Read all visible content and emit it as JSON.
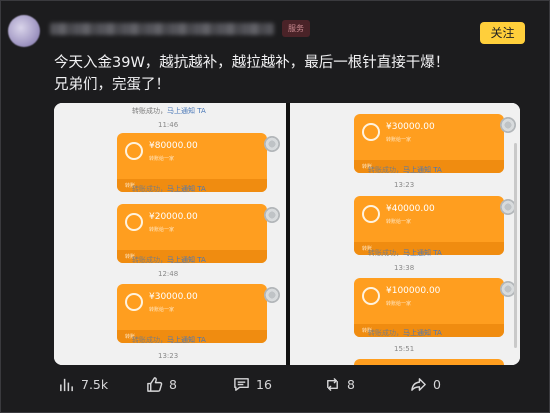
{
  "header": {
    "follow_label": "关注",
    "tag_label": "服务"
  },
  "post": {
    "line1": "今天入金39W，越抗越补，越拉越补，最后一根针直接干爆！",
    "line2": "兄弟们，完蛋了！"
  },
  "screenshot": {
    "left": {
      "top_status": "转账成功，",
      "top_link": "马上通知 TA",
      "bubbles": [
        {
          "amount": "¥80000.00",
          "sub": "转账给一家",
          "foot": "转账"
        },
        {
          "amount": "¥20000.00",
          "sub": "转账给一家",
          "foot": "转账"
        },
        {
          "amount": "¥30000.00",
          "sub": "转账给一家",
          "foot": "转账"
        }
      ],
      "times": [
        "11:46",
        "12:48",
        "13:23"
      ],
      "status": "转账成功，",
      "link": "马上通知 TA"
    },
    "right": {
      "bubbles": [
        {
          "amount": "¥30000.00",
          "sub": "转账给一家",
          "foot": "转账"
        },
        {
          "amount": "¥40000.00",
          "sub": "转账给一家",
          "foot": "转账"
        },
        {
          "amount": "¥100000.00",
          "sub": "转账给一家",
          "foot": "转账"
        }
      ],
      "times": [
        "13:23",
        "13:38",
        "15:51"
      ],
      "status": "转账成功，",
      "link": "马上通知 TA"
    }
  },
  "actions": {
    "views": "7.5k",
    "likes": "8",
    "comments": "16",
    "reposts": "8",
    "shares": "0"
  },
  "colors": {
    "accent": "#ffcf3b",
    "transfer_orange": "#ff9e1f",
    "background": "#1c1c1e"
  }
}
